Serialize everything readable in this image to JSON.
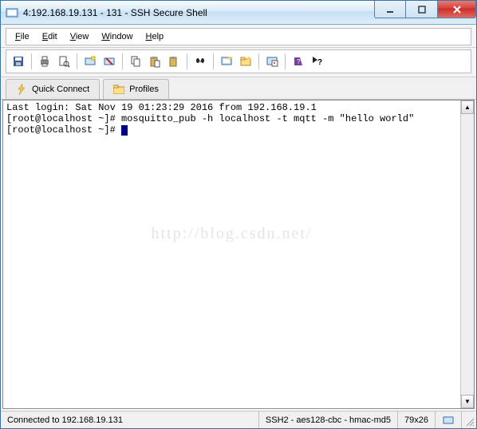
{
  "window": {
    "title": "4:192.168.19.131 - 131 - SSH Secure Shell"
  },
  "menu": {
    "file": "File",
    "edit": "Edit",
    "view": "View",
    "window": "Window",
    "help": "Help"
  },
  "toolbar": {
    "icons": {
      "save": "save-icon",
      "print": "print-icon",
      "printpreview": "print-preview-icon",
      "new": "new-session-icon",
      "disconnect": "disconnect-icon",
      "copy": "copy-icon",
      "paste": "paste-icon",
      "paste2": "paste-selection-icon",
      "find": "find-icon",
      "terminal": "new-terminal-icon",
      "sftp": "new-file-transfer-icon",
      "settings": "settings-icon",
      "help": "help-icon",
      "contexthelp": "contexthelp-icon"
    }
  },
  "connbar": {
    "quick_connect": "Quick Connect",
    "profiles": "Profiles"
  },
  "terminal": {
    "line1": "Last login: Sat Nov 19 01:23:29 2016 from 192.168.19.1",
    "line2": "[root@localhost ~]# mosquitto_pub -h localhost -t mqtt -m \"hello world\"",
    "line3_prompt": "[root@localhost ~]# ",
    "watermark": "http://blog.csdn.net/"
  },
  "status": {
    "connected": "Connected to 192.168.19.131",
    "cipher": "SSH2 - aes128-cbc - hmac-md5",
    "size": "79x26"
  }
}
